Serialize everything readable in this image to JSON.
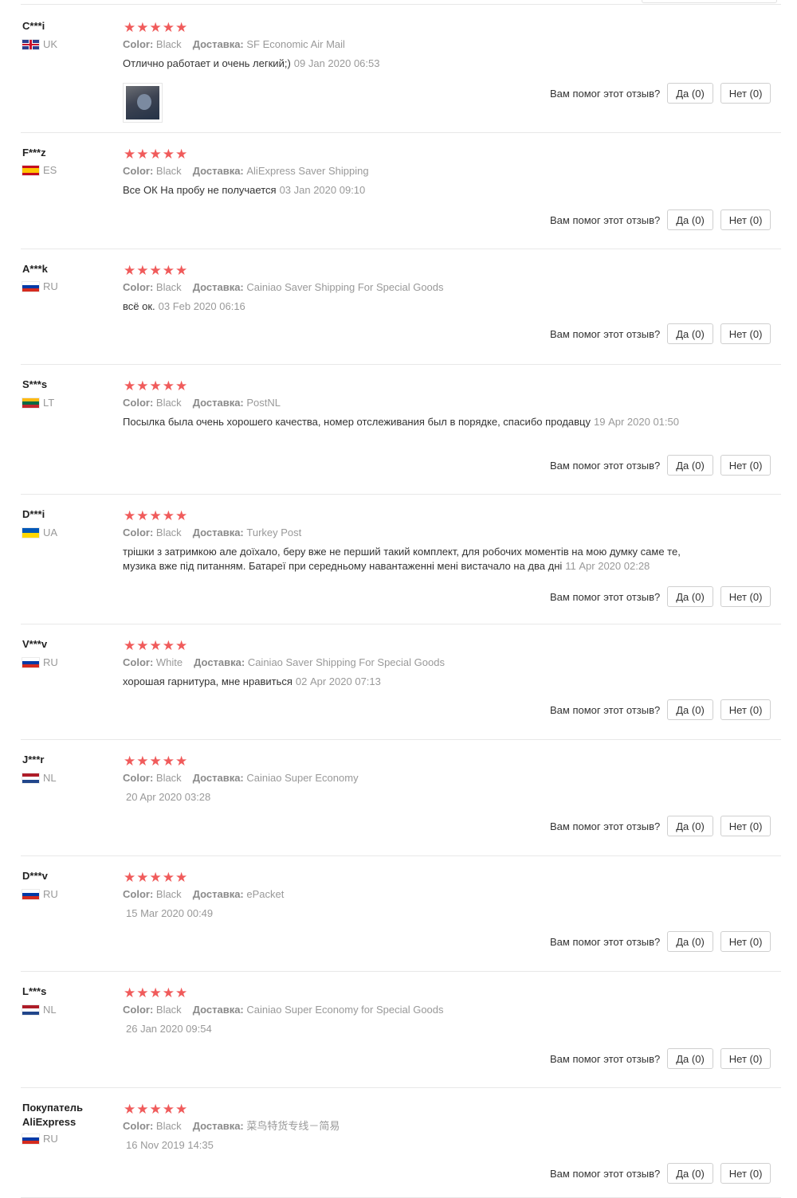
{
  "labels": {
    "color_key": "Color:",
    "delivery_key": "Доставка:",
    "helpful_question": "Вам помог этот отзыв?",
    "yes_button": "Да (0)",
    "no_button": "Нет (0)",
    "stars": "★★★★★"
  },
  "colors": {
    "star": "#f05b5b",
    "muted_text": "#999999",
    "separator": "#e8e8e8"
  },
  "reviews": [
    {
      "user": "C***i",
      "country": "UK",
      "rating": 5,
      "color": "Black",
      "delivery": "SF Economic Air Mail",
      "comment": "Отлично работает и очень легкий;)",
      "date": "09 Jan 2020 06:53",
      "has_photo": true
    },
    {
      "user": "F***z",
      "country": "ES",
      "rating": 5,
      "color": "Black",
      "delivery": "AliExpress Saver Shipping",
      "comment": "Все ОК На пробу не получается",
      "date": "03 Jan 2020 09:10",
      "has_photo": false
    },
    {
      "user": "A***k",
      "country": "RU",
      "rating": 5,
      "color": "Black",
      "delivery": "Cainiao Saver Shipping For Special Goods",
      "comment": "всё ок.",
      "date": "03 Feb 2020 06:16",
      "has_photo": false
    },
    {
      "user": "S***s",
      "country": "LT",
      "rating": 5,
      "color": "Black",
      "delivery": "PostNL",
      "comment": "Посылка была очень хорошего качества, номер отслеживания был в порядке, спасибо продавцу",
      "date": "19 Apr 2020 01:50",
      "has_photo": false
    },
    {
      "user": "D***i",
      "country": "UA",
      "rating": 5,
      "color": "Black",
      "delivery": "Turkey Post",
      "comment": "трішки з затримкою але доїхало, беру вже не перший такий комплект, для робочих моментів на мою думку саме те, музика вже під питанням. Батареї при середньому навантаженні мені вистачало на два дні",
      "date": "11 Apr 2020 02:28",
      "has_photo": false
    },
    {
      "user": "V***v",
      "country": "RU",
      "rating": 5,
      "color": "White",
      "delivery": "Cainiao Saver Shipping For Special Goods",
      "comment": "хорошая гарнитура, мне нравиться",
      "date": "02 Apr 2020 07:13",
      "has_photo": false
    },
    {
      "user": "J***r",
      "country": "NL",
      "rating": 5,
      "color": "Black",
      "delivery": "Cainiao Super Economy",
      "comment": "",
      "date": "20 Apr 2020 03:28",
      "has_photo": false
    },
    {
      "user": "D***v",
      "country": "RU",
      "rating": 5,
      "color": "Black",
      "delivery": "ePacket",
      "comment": "",
      "date": "15 Mar 2020 00:49",
      "has_photo": false
    },
    {
      "user": "L***s",
      "country": "NL",
      "rating": 5,
      "color": "Black",
      "delivery": "Cainiao Super Economy for Special Goods",
      "comment": "",
      "date": "26 Jan 2020 09:54",
      "has_photo": false
    },
    {
      "user": "Покупатель AliExpress",
      "country": "RU",
      "rating": 5,
      "color": "Black",
      "delivery": "菜鸟特货专线－简易",
      "comment": "",
      "date": "16 Nov 2019 14:35",
      "has_photo": false
    }
  ]
}
